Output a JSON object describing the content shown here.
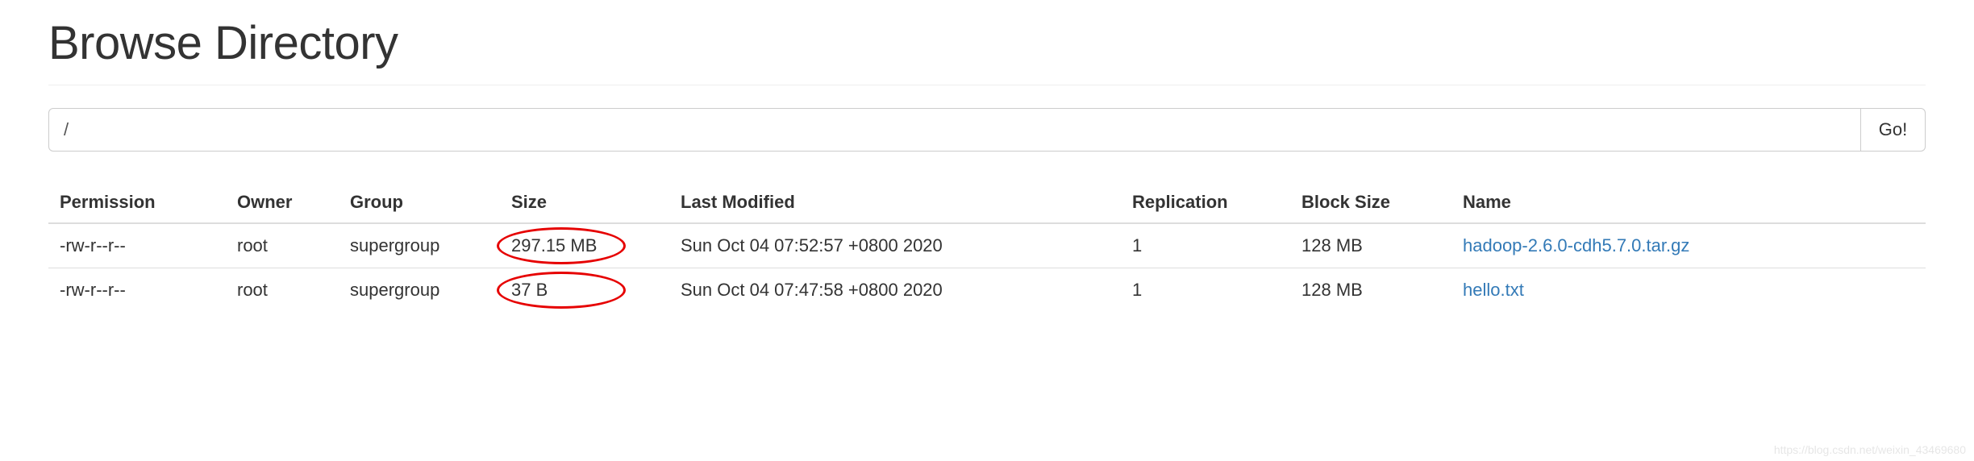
{
  "page": {
    "title": "Browse Directory",
    "path_value": "/",
    "go_label": "Go!"
  },
  "table": {
    "headers": {
      "permission": "Permission",
      "owner": "Owner",
      "group": "Group",
      "size": "Size",
      "last_modified": "Last Modified",
      "replication": "Replication",
      "block_size": "Block Size",
      "name": "Name"
    },
    "rows": [
      {
        "permission": "-rw-r--r--",
        "owner": "root",
        "group": "supergroup",
        "size": "297.15 MB",
        "last_modified": "Sun Oct 04 07:52:57 +0800 2020",
        "replication": "1",
        "block_size": "128 MB",
        "name": "hadoop-2.6.0-cdh5.7.0.tar.gz"
      },
      {
        "permission": "-rw-r--r--",
        "owner": "root",
        "group": "supergroup",
        "size": "37 B",
        "last_modified": "Sun Oct 04 07:47:58 +0800 2020",
        "replication": "1",
        "block_size": "128 MB",
        "name": "hello.txt"
      }
    ]
  },
  "annotations": {
    "size_highlight": true
  },
  "watermark": "https://blog.csdn.net/weixin_43469680"
}
